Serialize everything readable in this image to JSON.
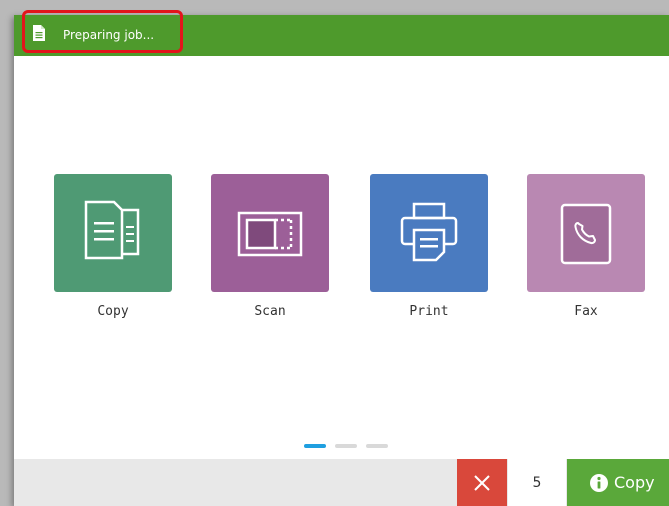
{
  "status": {
    "icon": "document-icon",
    "text": "Preparing job..."
  },
  "apps": [
    {
      "label": "Copy",
      "icon": "copy-icon",
      "color": "#4f9a74"
    },
    {
      "label": "Scan",
      "icon": "scan-icon",
      "color": "#9c5f98"
    },
    {
      "label": "Print",
      "icon": "print-icon",
      "color": "#4a7bc0"
    },
    {
      "label": "Fax",
      "icon": "fax-icon",
      "color": "#b988b2"
    }
  ],
  "pager": {
    "pages": 3,
    "active": 1,
    "active_color": "#1f9fe0"
  },
  "bottom_bar": {
    "cancel_icon": "close-icon",
    "copies_value": "5",
    "start_label": "Copy",
    "start_icon": "info-icon"
  },
  "colors": {
    "status_bar": "#4e9a2c",
    "highlight": "#e3141b",
    "cancel": "#d9483b",
    "start": "#5aa83a"
  }
}
